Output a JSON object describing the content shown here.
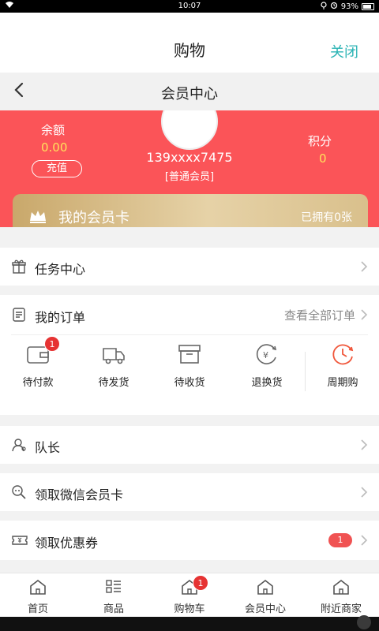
{
  "status_bar": {
    "time": "10:07",
    "battery": "93%"
  },
  "header": {
    "title": "购物",
    "close_label": "关闭"
  },
  "nav": {
    "title": "会员中心"
  },
  "member": {
    "balance_label": "余额",
    "balance_value": "0.00",
    "recharge_label": "充值",
    "phone": "139xxxx7475",
    "level": "[普通会员]",
    "points_label": "积分",
    "points_value": "0",
    "card_title": "我的会员卡",
    "card_owned": "已拥有0张"
  },
  "tasks": {
    "label": "任务中心"
  },
  "orders": {
    "title": "我的订单",
    "view_all": "查看全部订单",
    "items": [
      {
        "label": "待付款",
        "badge": "1"
      },
      {
        "label": "待发货"
      },
      {
        "label": "待收货"
      },
      {
        "label": "退换货"
      },
      {
        "label": "周期购"
      }
    ]
  },
  "captain": {
    "label": "队长"
  },
  "wechat_card": {
    "label": "领取微信会员卡"
  },
  "coupons": {
    "label": "领取优惠券",
    "count": "1"
  },
  "tabs": [
    {
      "label": "首页"
    },
    {
      "label": "商品"
    },
    {
      "label": "购物车",
      "badge": "1"
    },
    {
      "label": "会员中心"
    },
    {
      "label": "附近商家"
    }
  ],
  "colors": {
    "brand_red": "#fb5458",
    "accent_teal": "#2ab3b4",
    "gold_value": "#ffe25b",
    "badge_red": "#e63333",
    "cycle_orange": "#f0563a"
  },
  "icons": {
    "status_left": "wifi-icon",
    "status_right": [
      "location-icon",
      "alarm-icon",
      "battery-icon"
    ],
    "back": "chevron-left-icon",
    "card": "crown-icon",
    "tasks": "gift-icon",
    "orders": "clipboard-icon",
    "order_items": [
      "wallet-icon",
      "truck-icon",
      "box-icon",
      "refund-icon",
      "clock-icon"
    ],
    "captain": "user-icon",
    "wechat_card": "card-search-icon",
    "coupons": "ticket-icon",
    "tabs": [
      "home-icon",
      "list-icon",
      "cart-home-icon",
      "member-home-icon",
      "store-home-icon"
    ]
  }
}
